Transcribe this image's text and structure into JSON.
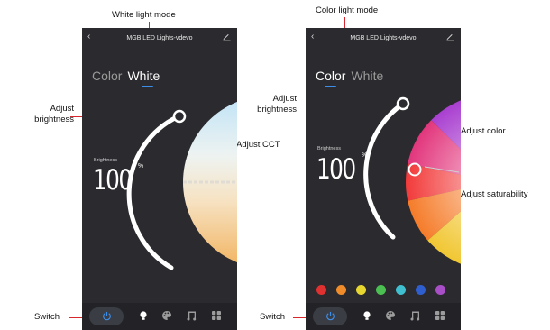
{
  "left": {
    "title_annotation": "White light mode",
    "header_title": "MGB LED Lights-vdevo",
    "tab_color": "Color",
    "tab_white": "White",
    "active_tab": "White",
    "brightness_label": "Brightness",
    "brightness_value": "100",
    "brightness_unit": "%",
    "annotation_brightness": "Adjust\nbrightness",
    "annotation_cct": "Adjust CCT",
    "annotation_switch": "Switch"
  },
  "right": {
    "title_annotation": "Color light mode",
    "header_title": "MGB LED Lights-vdevo",
    "tab_color": "Color",
    "tab_white": "White",
    "active_tab": "Color",
    "brightness_label": "Brightness",
    "brightness_value": "100",
    "brightness_unit": "%",
    "annotation_brightness": "Adjust\nbrightness",
    "annotation_color": "Adjust color",
    "annotation_saturability": "Adjust saturability",
    "annotation_switch": "Switch",
    "swatches": [
      "#e03131",
      "#f08c2a",
      "#e8d630",
      "#4cbf52",
      "#3fbfcf",
      "#2f5fcf",
      "#a84fc7"
    ]
  },
  "icons": {
    "back": "back-arrow-icon",
    "edit": "edit-pencil-icon",
    "power": "power-icon",
    "bulb": "bulb-icon",
    "palette": "palette-icon",
    "music": "music-icon",
    "grid": "grid-icon"
  },
  "colors": {
    "accent": "#3d8ee8",
    "annotation_line": "#d9262e",
    "phone_bg": "#2b2b2f"
  }
}
